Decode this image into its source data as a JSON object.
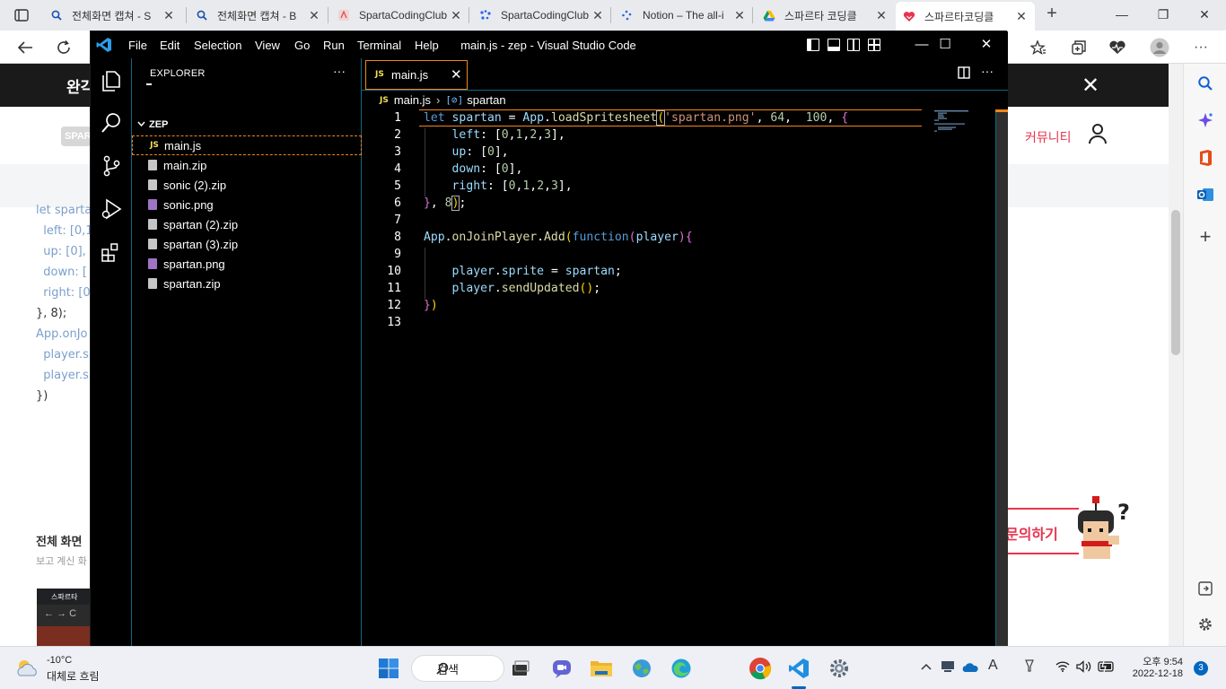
{
  "browser": {
    "tabs": [
      {
        "title": "전체화면 캡쳐 - S",
        "icon": "search-icon",
        "active": false
      },
      {
        "title": "전체화면 캡쳐 - B",
        "icon": "search-icon",
        "active": false
      },
      {
        "title": "SpartaCodingClub",
        "icon": "sparta-favicon",
        "active": false
      },
      {
        "title": "SpartaCodingClub",
        "icon": "dots-favicon",
        "active": false
      },
      {
        "title": "Notion – The all-i",
        "icon": "notion-favicon",
        "active": false
      },
      {
        "title": "스파르타 코딩클",
        "icon": "google-drive-icon",
        "active": false
      },
      {
        "title": "스파르타코딩클",
        "icon": "heart-favicon",
        "active": true
      }
    ],
    "new_tab": "+",
    "window_controls": {
      "minimize": "—",
      "restore": "❐",
      "close": "✕"
    }
  },
  "webpage": {
    "banner_text": "완각",
    "banner_close": "✕",
    "logo_text": "SPAR",
    "community_link": "커뮤니티",
    "code_lines": [
      "let sparta",
      "  left: [0,1",
      "  up: [0],",
      "  down: [",
      "  right: [0",
      "}, 8);",
      "",
      "App.onJo",
      "",
      "  player.s",
      "  player.s",
      "})"
    ],
    "heading": "전체 화면 ",
    "subtext": "보고 계신 화",
    "thumb_title": "스파르타",
    "inquiry_button": "문의하기"
  },
  "vscode": {
    "menu": [
      "File",
      "Edit",
      "Selection",
      "View",
      "Go",
      "Run",
      "Terminal",
      "Help"
    ],
    "window_title": "main.js - zep - Visual Studio Code",
    "explorer": {
      "header": "EXPLORER",
      "more": "···",
      "folder": "ZEP",
      "files": [
        {
          "name": "main.js",
          "type": "js",
          "selected": true
        },
        {
          "name": "main.zip",
          "type": "zip",
          "selected": false
        },
        {
          "name": "sonic (2).zip",
          "type": "zip",
          "selected": false
        },
        {
          "name": "sonic.png",
          "type": "png",
          "selected": false
        },
        {
          "name": "spartan (2).zip",
          "type": "zip",
          "selected": false
        },
        {
          "name": "spartan (3).zip",
          "type": "zip",
          "selected": false
        },
        {
          "name": "spartan.png",
          "type": "png",
          "selected": false
        },
        {
          "name": "spartan.zip",
          "type": "zip",
          "selected": false
        }
      ]
    },
    "editor": {
      "tab_name": "main.js",
      "tab_badge": "JS",
      "tab_close": "✕",
      "more": "···",
      "breadcrumb": {
        "file": "main.js",
        "symbol": "spartan",
        "symbol_glyph": "[⊘]"
      },
      "line_numbers": [
        "1",
        "2",
        "3",
        "4",
        "5",
        "6",
        "7",
        "8",
        "9",
        "10",
        "11",
        "12",
        "13"
      ]
    }
  },
  "taskbar": {
    "temperature": "-10°C",
    "weather": "대체로 흐림",
    "search_label": "검색",
    "time": "오후 9:54",
    "date": "2022-12-18",
    "notification_count": "3"
  }
}
